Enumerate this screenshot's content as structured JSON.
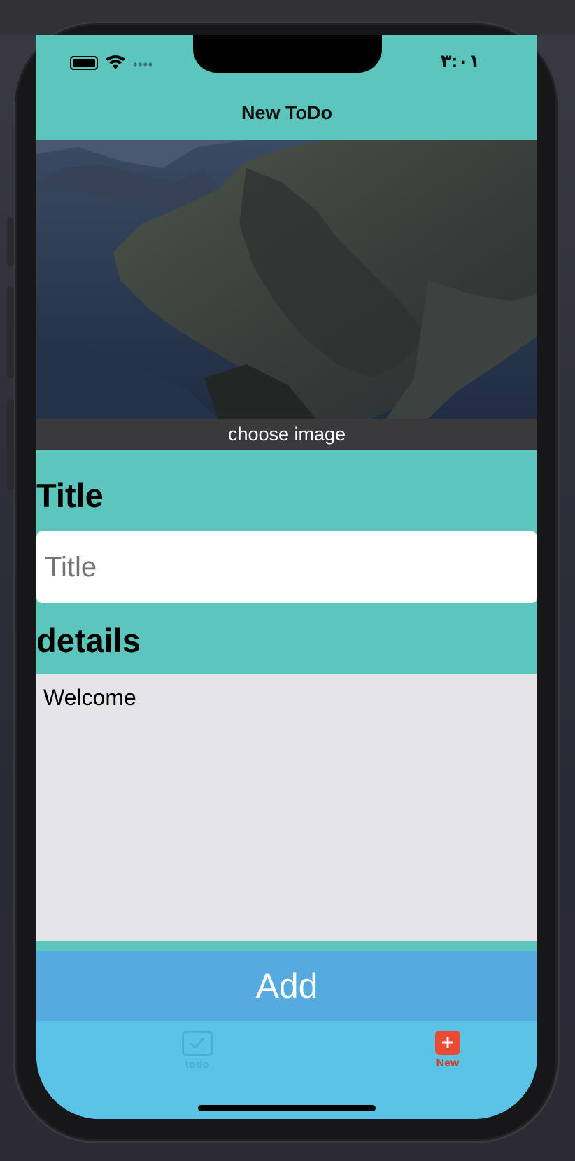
{
  "status_bar": {
    "time": "٣:٠١",
    "signal_dots": "••••"
  },
  "nav": {
    "title": "New ToDo"
  },
  "image_picker": {
    "button_label": "choose image"
  },
  "form": {
    "title_label": "Title",
    "title_input": {
      "placeholder": "Title",
      "value": ""
    },
    "details_label": "details",
    "details_text": "Welcome"
  },
  "actions": {
    "add_label": "Add"
  },
  "tab_bar": {
    "tabs": [
      {
        "label": "todo",
        "icon": "checkmark-square-icon",
        "selected": false
      },
      {
        "label": "New",
        "icon": "plus-square-icon",
        "selected": true
      }
    ]
  },
  "colors": {
    "background": "#5cc5bc",
    "add_button": "#55aae0",
    "tab_bar": "#5ac3e6",
    "selected_tab": "#e94b35",
    "details_field": "#e4e4e9"
  }
}
